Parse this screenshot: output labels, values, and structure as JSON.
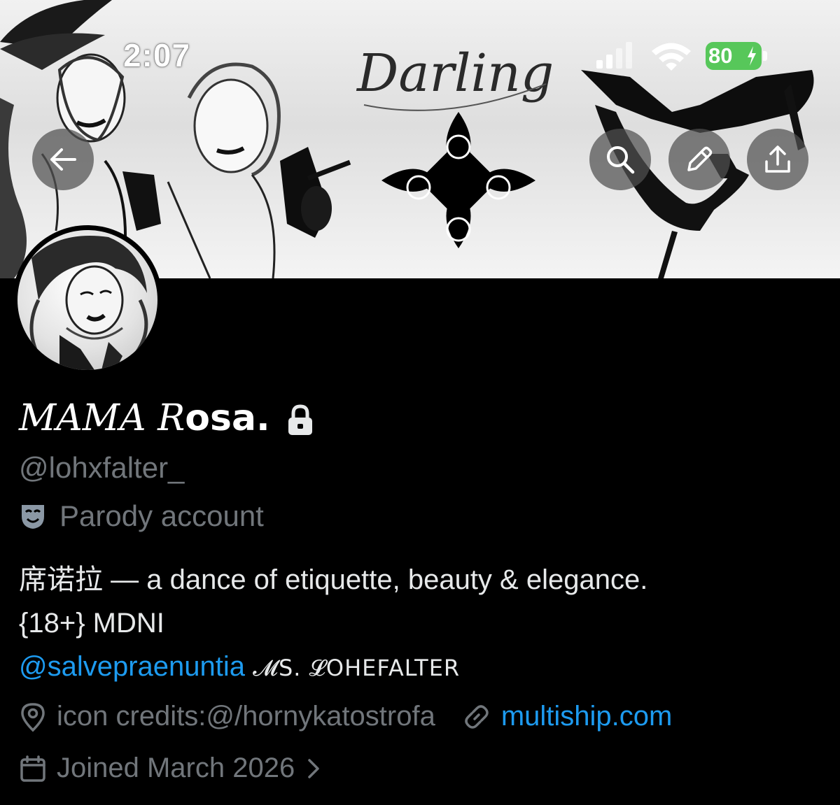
{
  "status_bar": {
    "time": "2:07",
    "battery": "80"
  },
  "banner": {
    "script_title": "Darling",
    "colors": {
      "button_bg": "#505050",
      "banner_bg": "#e6e6e6"
    }
  },
  "nav": {
    "back_icon": "arrow-left-icon",
    "search_icon": "search-icon",
    "edit_icon": "pencil-icon",
    "share_icon": "share-icon"
  },
  "profile": {
    "display_name_styled": "𝑀𝐴𝑀𝐴 𝑅",
    "display_name_rest": "osa.",
    "handle": "@lohxfalter_",
    "label": "Parody account",
    "bio_line1": "席诺拉 — a dance of etiquette, beauty & elegance.",
    "bio_line2": "{18+} MDNI",
    "bio_mention": "@salvepraenuntia",
    "bio_mention_name": "𝓜S. 𝓛OHEFALTER",
    "location": "icon credits:@/hornykatostrofa",
    "website": "multiship.com",
    "joined": "Joined March 2026"
  },
  "colors": {
    "accent": "#1d9bf0",
    "muted": "#71767b",
    "text": "#e7e9ea",
    "background": "#000000",
    "battery": "#57c75a"
  }
}
